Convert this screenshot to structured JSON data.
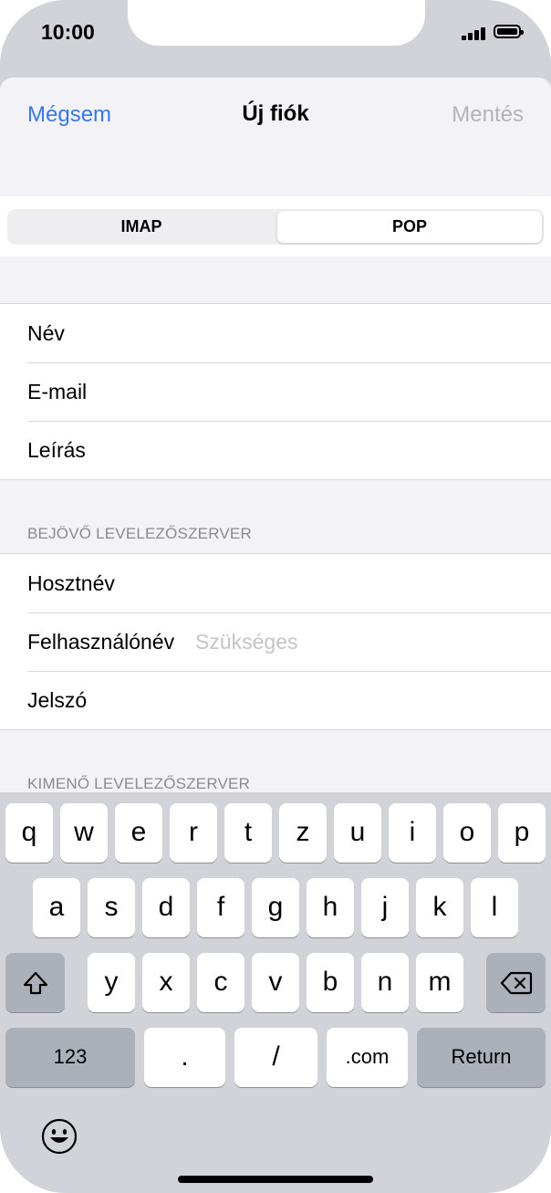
{
  "status_bar": {
    "time": "10:00"
  },
  "nav": {
    "cancel_label": "Mégsem",
    "title": "Új fiók",
    "save_label": "Mentés"
  },
  "segment": {
    "options": [
      "IMAP",
      "POP"
    ],
    "selected": "POP"
  },
  "account_fields": [
    {
      "label": "Név"
    },
    {
      "label": "E-mail"
    },
    {
      "label": "Leírás"
    }
  ],
  "incoming": {
    "header": "BEJÖVŐ LEVELEZŐSZERVER",
    "fields": [
      {
        "label": "Hosztnév"
      },
      {
        "label": "Felhasználónév",
        "placeholder": "Szükséges"
      },
      {
        "label": "Jelszó"
      }
    ]
  },
  "outgoing": {
    "header": "KIMENŐ LEVELEZŐSZERVER"
  },
  "keyboard": {
    "row1": [
      "q",
      "w",
      "e",
      "r",
      "t",
      "z",
      "u",
      "i",
      "o",
      "p"
    ],
    "row2": [
      "a",
      "s",
      "d",
      "f",
      "g",
      "h",
      "j",
      "k",
      "l"
    ],
    "row3": [
      "y",
      "x",
      "c",
      "v",
      "b",
      "n",
      "m"
    ],
    "row4": {
      "numbers": "123",
      "dot": ".",
      "slash": "/",
      "dotcom": ".com",
      "return": "Return"
    },
    "icons": {
      "shift": "shift-icon",
      "delete": "delete-icon",
      "emoji": "emoji-icon"
    }
  },
  "colors": {
    "accent": "#3478f6",
    "disabled": "#b4b4b8",
    "placeholder": "#c4c4c8",
    "keyboard_bg": "#d1d3d9"
  }
}
